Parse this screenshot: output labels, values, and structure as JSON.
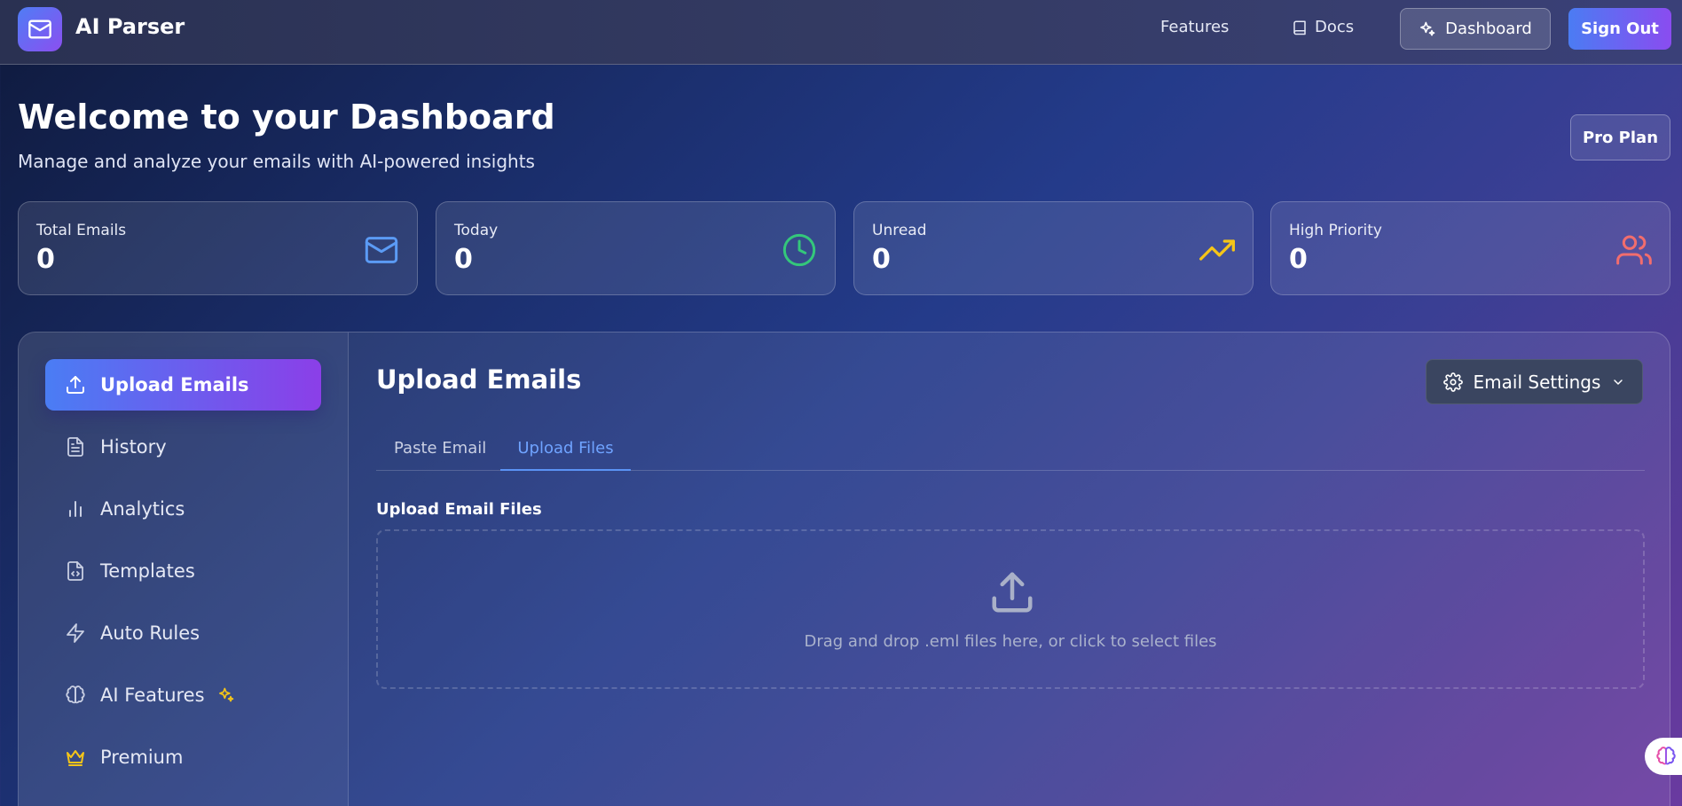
{
  "app": {
    "name": "AI Parser"
  },
  "nav": {
    "features": "Features",
    "docs": "Docs",
    "dashboard": "Dashboard",
    "sign_out": "Sign Out"
  },
  "header": {
    "title": "Welcome to your Dashboard",
    "subtitle": "Manage and analyze your emails with AI-powered insights",
    "plan_badge": "Pro Plan"
  },
  "stats": [
    {
      "label": "Total Emails",
      "value": "0",
      "icon": "mail-icon",
      "color": "#5b9bf5"
    },
    {
      "label": "Today",
      "value": "0",
      "icon": "clock-icon",
      "color": "#34c77b"
    },
    {
      "label": "Unread",
      "value": "0",
      "icon": "trending-up-icon",
      "color": "#f5c518"
    },
    {
      "label": "High Priority",
      "value": "0",
      "icon": "users-icon",
      "color": "#f26d6d"
    }
  ],
  "sidebar": {
    "items": [
      {
        "label": "Upload Emails",
        "icon": "upload-icon",
        "active": true
      },
      {
        "label": "History",
        "icon": "file-text-icon"
      },
      {
        "label": "Analytics",
        "icon": "bar-chart-icon"
      },
      {
        "label": "Templates",
        "icon": "file-code-icon"
      },
      {
        "label": "Auto Rules",
        "icon": "lightning-icon"
      },
      {
        "label": "AI Features",
        "icon": "brain-icon"
      },
      {
        "label": "Premium",
        "icon": "crown-icon"
      }
    ]
  },
  "content": {
    "title": "Upload Emails",
    "settings_button": "Email Settings",
    "tabs": [
      {
        "label": "Paste Email",
        "active": false
      },
      {
        "label": "Upload Files",
        "active": true
      }
    ],
    "upload_label": "Upload Email Files",
    "dropzone_text": "Drag and drop .eml files here, or click to select files"
  },
  "colors": {
    "accent_blue": "#4a7df4",
    "accent_purple": "#8b3fe8",
    "tab_active": "#6fa3ff"
  }
}
